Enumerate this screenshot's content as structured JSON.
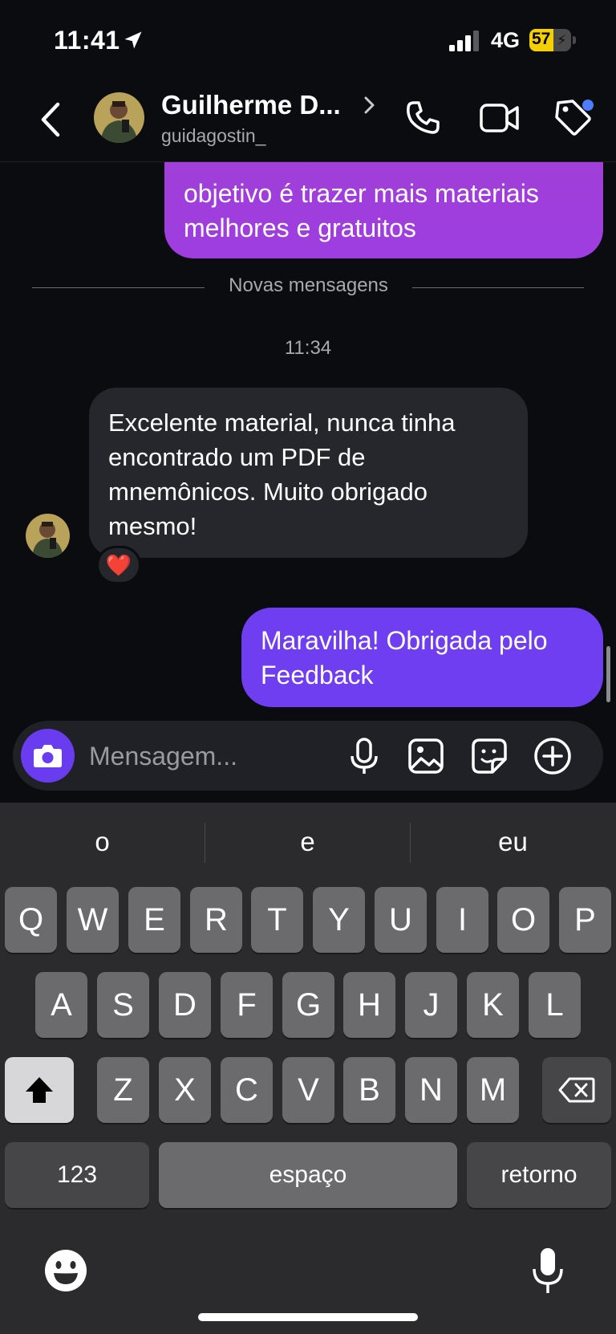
{
  "status": {
    "time": "11:41",
    "network": "4G",
    "battery": "57",
    "battery_level": 0.57,
    "signal_bars": 3
  },
  "header": {
    "contact_name": "Guilherme D...",
    "handle": "guidagostin_",
    "has_notification_dot": true
  },
  "messages": {
    "outgoing_top_text": "objetivo é trazer mais materiais melhores e gratuitos",
    "divider_label": "Novas mensagens",
    "timestamp": "11:34",
    "incoming_text": "Excelente material, nunca tinha encontrado um PDF de mnemônicos. Muito obrigado mesmo!",
    "reaction": "❤️",
    "outgoing_last_text": "Maravilha! Obrigada pelo Feedback"
  },
  "composer": {
    "placeholder": "Mensagem..."
  },
  "keyboard": {
    "suggestions": [
      "o",
      "e",
      "eu"
    ],
    "row1": [
      "Q",
      "W",
      "E",
      "R",
      "T",
      "Y",
      "U",
      "I",
      "O",
      "P"
    ],
    "row2": [
      "A",
      "S",
      "D",
      "F",
      "G",
      "H",
      "J",
      "K",
      "L"
    ],
    "row3": [
      "Z",
      "X",
      "C",
      "V",
      "B",
      "N",
      "M"
    ],
    "numbers_label": "123",
    "space_label": "espaço",
    "return_label": "retorno"
  },
  "colors": {
    "background": "#0b0c10",
    "outgoing_purple": "#6f3ef0",
    "outgoing_magenta": "#a13fd6",
    "incoming_bubble": "#25272d",
    "accent_blue_dot": "#4f7cff"
  },
  "icons": [
    "location-arrow-icon",
    "signal-icon",
    "battery-icon",
    "back-chevron-icon",
    "phone-icon",
    "video-icon",
    "tag-icon",
    "camera-icon",
    "mic-icon",
    "gallery-icon",
    "sticker-icon",
    "plus-circle-icon",
    "shift-icon",
    "delete-icon",
    "emoji-icon",
    "dictation-mic-icon"
  ]
}
